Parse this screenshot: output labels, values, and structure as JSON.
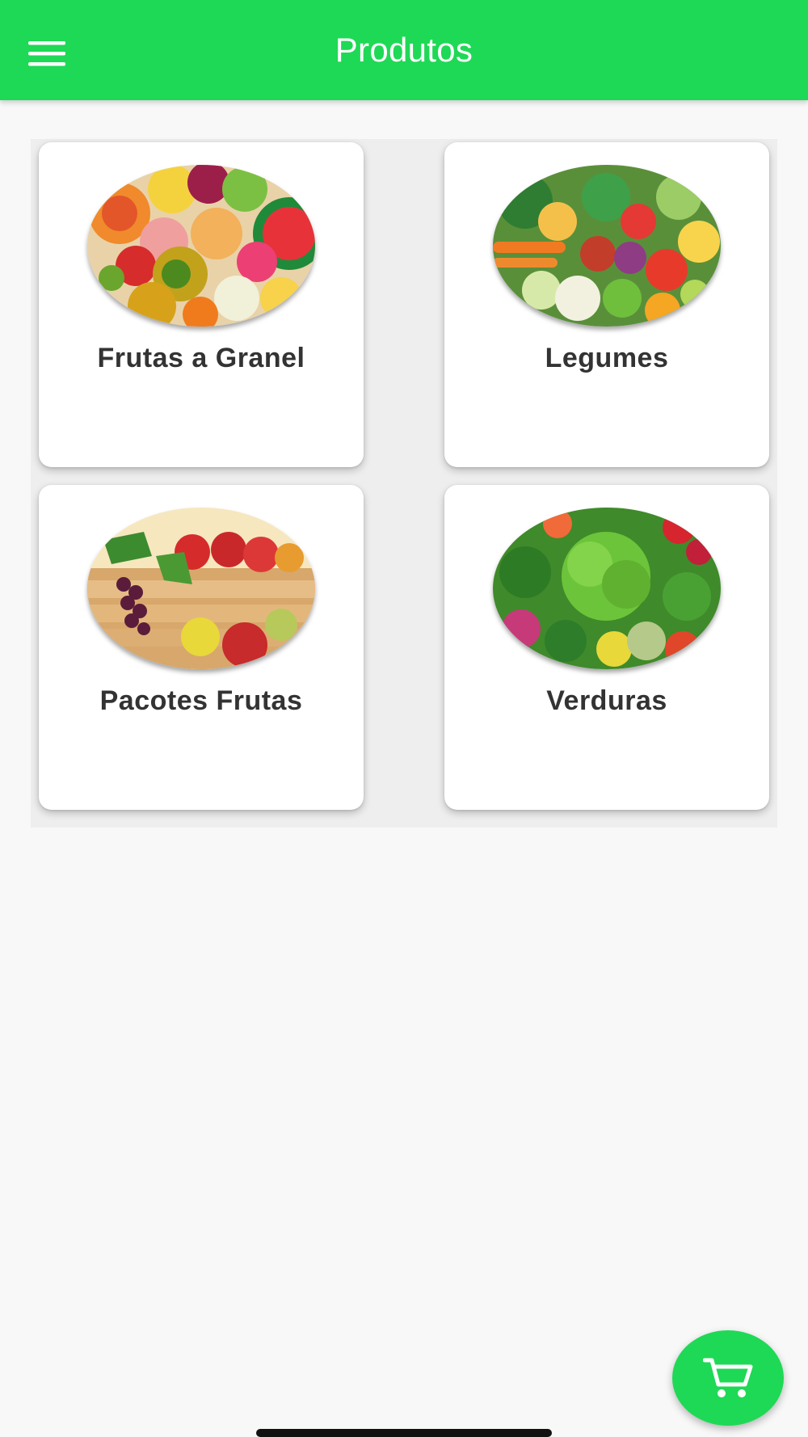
{
  "app_bar": {
    "title": "Produtos",
    "menu_icon": "hamburger-menu-icon",
    "color": "#1ed955"
  },
  "categories": [
    {
      "label": "Frutas a Granel",
      "image": "assorted-fruits-photo"
    },
    {
      "label": "Legumes",
      "image": "assorted-vegetables-photo"
    },
    {
      "label": "Pacotes Frutas",
      "image": "fruit-crate-photo"
    },
    {
      "label": "Verduras",
      "image": "leafy-greens-photo"
    }
  ],
  "fab": {
    "icon": "shopping-cart-icon",
    "color": "#1ed955"
  }
}
